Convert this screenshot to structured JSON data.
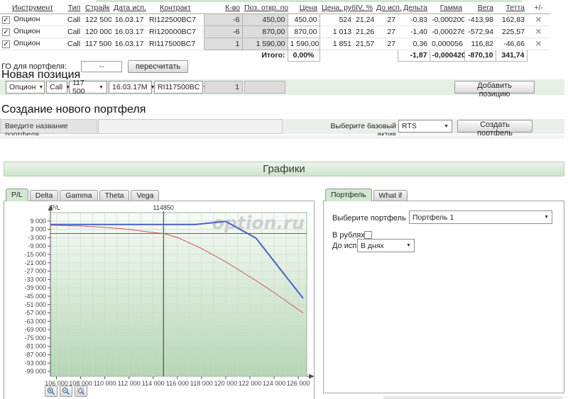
{
  "table": {
    "headers": [
      "Инструмент",
      "Тип",
      "Страйк",
      "Дата исп.",
      "Контракт",
      "К-во",
      "Поз. откр. по",
      "Цена",
      "Цена, руб.",
      "IV, %",
      "До исп.",
      "Дельта",
      "Гамма",
      "Вега",
      "Тетта",
      "+/-"
    ],
    "rows": [
      {
        "checked": true,
        "instrument": "Опцион",
        "type": "Call",
        "strike": "122 500",
        "exp_date": "16.03.17",
        "contract": "RI122500BC7",
        "qty": "-6",
        "open_pos": "450,00",
        "price": "450,00",
        "price_rub": "524",
        "iv": "21,24",
        "days": "27",
        "delta": "-0,83",
        "gamma": "-0,000200",
        "vega": "-413,98",
        "theta": "162,83",
        "delete_icon": "close-icon"
      },
      {
        "checked": true,
        "instrument": "Опцион",
        "type": "Call",
        "strike": "120 000",
        "exp_date": "16.03.17",
        "contract": "RI120000BC7",
        "qty": "-6",
        "open_pos": "870,00",
        "price": "870,00",
        "price_rub": "1 013",
        "iv": "21,26",
        "days": "27",
        "delta": "-1,40",
        "gamma": "-0,000276",
        "vega": "-572,94",
        "theta": "225,57",
        "delete_icon": "close-icon"
      },
      {
        "checked": true,
        "instrument": "Опцион",
        "type": "Call",
        "strike": "117 500",
        "exp_date": "16.03.17",
        "contract": "RI117500BC7",
        "qty": "1",
        "open_pos": "1 590,00",
        "price": "1 590,00",
        "price_rub": "1 851",
        "iv": "21,57",
        "days": "27",
        "delta": "0,36",
        "gamma": "0,000056",
        "vega": "116,82",
        "theta": "-46,66",
        "delete_icon": "close-icon"
      }
    ],
    "totals": {
      "label": "Итого:",
      "percent": "0,00%",
      "delta": "-1,87",
      "gamma": "-0,000420",
      "vega": "-870,10",
      "theta": "341,74"
    }
  },
  "go_row": {
    "label": "ГО для портфеля:",
    "value": "--",
    "recalc_button": "пересчитать"
  },
  "new_position": {
    "title": "Новая позиция",
    "instrument": "Опцион",
    "type": "Call",
    "strike": "117 500",
    "date": "16.03.17М",
    "contract": "RI117500BC",
    "qty": "1",
    "add_button": "Добавить позицию"
  },
  "new_portfolio": {
    "title": "Создание нового портфеля",
    "name_label": "Введите название портфеля",
    "name_value": "",
    "asset_label": "Выберите базовый актив",
    "asset_value": "RTS",
    "create_button": "Создать портфель"
  },
  "charts_section": {
    "title": "Графики",
    "tabs": [
      "P/L",
      "Delta",
      "Gamma",
      "Theta",
      "Vega"
    ],
    "active_tab": "P/L",
    "zoom_buttons": [
      "zoom-in",
      "zoom-out",
      "zoom-selection"
    ]
  },
  "right_panel": {
    "tabs": [
      "Портфель",
      "What if"
    ],
    "active_tab": "Портфель",
    "select_portfolio_label": "Выберите портфель",
    "portfolio_value": "Портфель 1",
    "rubles_label": "В рублях:",
    "rubles_checked": false,
    "days_label": "До исп.:",
    "days_value": "В днях"
  },
  "chart_data": {
    "type": "line",
    "title": "P/L",
    "ylabel": "P/L",
    "watermark": "option.ru",
    "current_price_marker": 114850,
    "xlim": [
      105500,
      126700
    ],
    "ylim": [
      -102500,
      15000
    ],
    "x_ticks": [
      106000,
      108000,
      110000,
      112000,
      114000,
      116000,
      118000,
      120000,
      122000,
      124000,
      126000
    ],
    "y_ticks": [
      9000,
      3000,
      -3000,
      -9000,
      -15000,
      -21000,
      -27000,
      -33000,
      -39000,
      -45000,
      -51000,
      -57000,
      -63000,
      -69000,
      -75000,
      -81000,
      -87000,
      -93000,
      -99000
    ],
    "x_minor_step": 1000,
    "zero_line": 0,
    "grid": true,
    "colors": {
      "expiration": "#4a5fc8",
      "current": "#cc5555",
      "marker": "#333333",
      "zero": "#666666",
      "plot_top": "#f7fbf7",
      "plot_bottom": "#b5d6b5",
      "grid_line": "#ccd8cc",
      "watermark": "#c6c6c6"
    },
    "series": [
      {
        "name": "expiration P/L",
        "color": "#4a5fc8",
        "width": 2,
        "points": [
          [
            105500,
            6500
          ],
          [
            117500,
            6500
          ],
          [
            120000,
            8700
          ],
          [
            122500,
            -3300
          ],
          [
            126400,
            -46500
          ]
        ]
      },
      {
        "name": "current P/L",
        "color": "#cc5555",
        "width": 1,
        "points": [
          [
            105500,
            6000
          ],
          [
            108000,
            5400
          ],
          [
            110000,
            4400
          ],
          [
            112000,
            2900
          ],
          [
            114000,
            700
          ],
          [
            114850,
            0
          ],
          [
            116000,
            -2800
          ],
          [
            118000,
            -10800
          ],
          [
            120000,
            -20300
          ],
          [
            122500,
            -33800
          ],
          [
            124000,
            -42500
          ],
          [
            126400,
            -57000
          ]
        ]
      }
    ]
  }
}
